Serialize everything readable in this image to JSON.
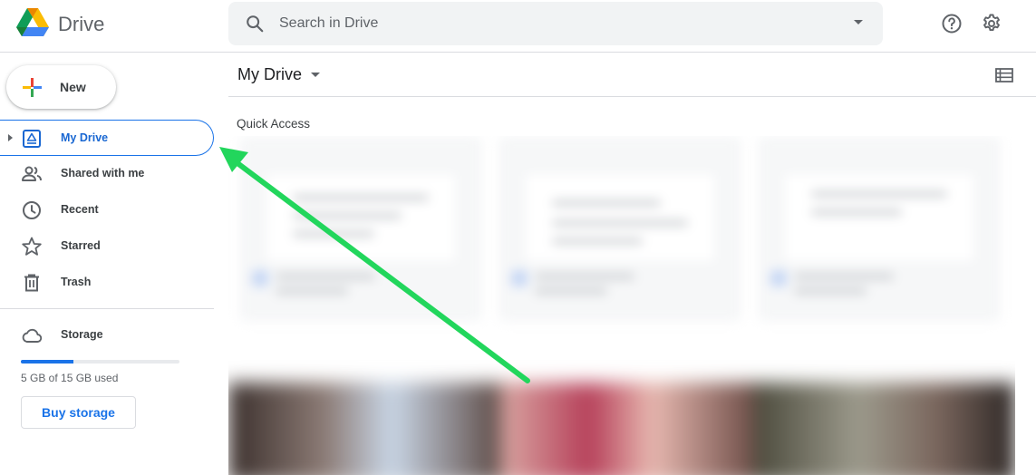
{
  "app": {
    "name": "Drive",
    "logo_icon": "google-drive-logo"
  },
  "search": {
    "placeholder": "Search in Drive",
    "value": ""
  },
  "header": {
    "help_icon": "help-icon",
    "settings_icon": "settings-icon"
  },
  "sidebar": {
    "new_label": "New",
    "items": [
      {
        "label": "My Drive",
        "icon": "my-drive-icon",
        "active": true
      },
      {
        "label": "Shared with me",
        "icon": "people-icon"
      },
      {
        "label": "Recent",
        "icon": "clock-icon"
      },
      {
        "label": "Starred",
        "icon": "star-icon"
      },
      {
        "label": "Trash",
        "icon": "trash-icon"
      }
    ],
    "storage": {
      "label": "Storage",
      "used_text": "5 GB of 15 GB used",
      "used_fraction": 0.33,
      "buy_label": "Buy storage"
    }
  },
  "main": {
    "title": "My Drive",
    "quick_access_label": "Quick Access"
  },
  "colors": {
    "accent": "#1a73e8",
    "annotation_arrow": "#22d65c"
  }
}
